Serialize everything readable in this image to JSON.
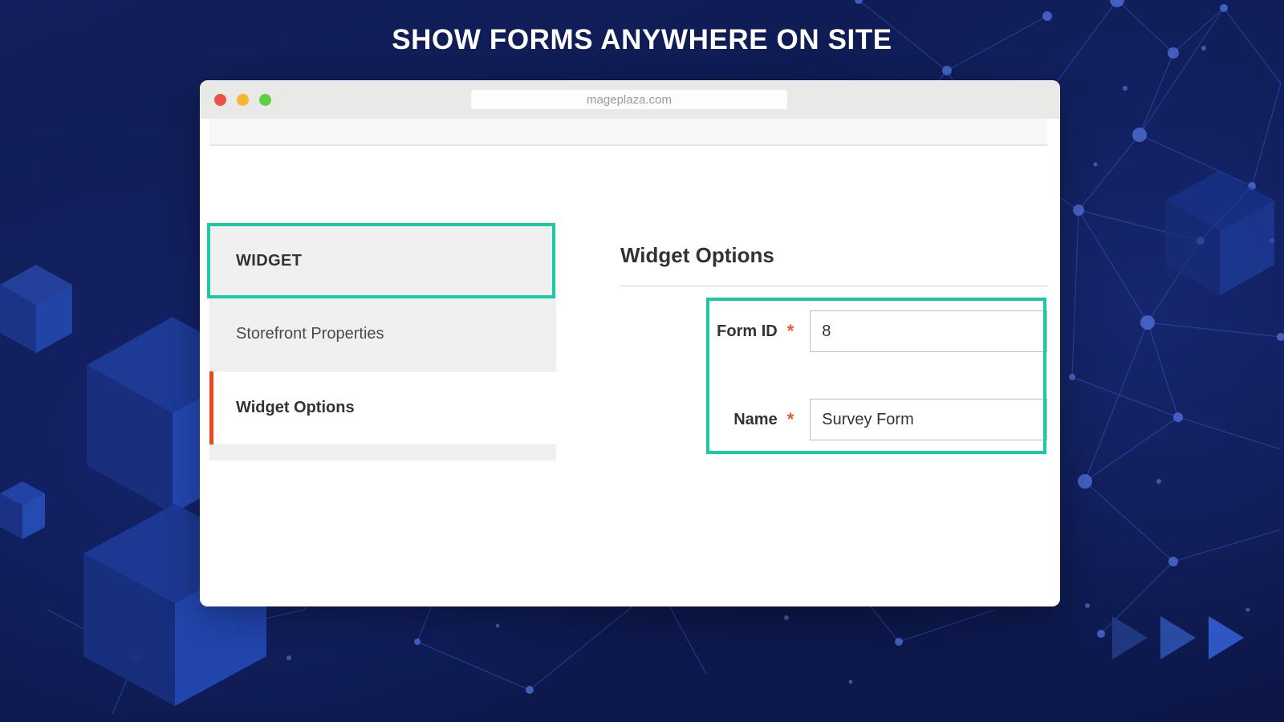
{
  "page": {
    "title": "SHOW FORMS ANYWHERE ON SITE",
    "background_color": "#0e1c55",
    "accent_color": "#1ec8a5",
    "active_marker_color": "#e8491e",
    "required_star_color": "#f0542d"
  },
  "browser": {
    "url": "mageplaza.com",
    "traffic_lights": [
      {
        "name": "close",
        "color": "#e8544a"
      },
      {
        "name": "minimize",
        "color": "#f5b731"
      },
      {
        "name": "maximize",
        "color": "#5ed044"
      }
    ]
  },
  "sidebar": {
    "header": "WIDGET",
    "items": [
      {
        "label": "Storefront Properties",
        "active": false
      },
      {
        "label": "Widget Options",
        "active": true
      }
    ]
  },
  "content": {
    "heading": "Widget Options",
    "fields": [
      {
        "label": "Form ID",
        "required_mark": "*",
        "value": "8",
        "placeholder": ""
      },
      {
        "label": "Name",
        "required_mark": "*",
        "value": "Survey Form",
        "placeholder": ""
      }
    ]
  }
}
